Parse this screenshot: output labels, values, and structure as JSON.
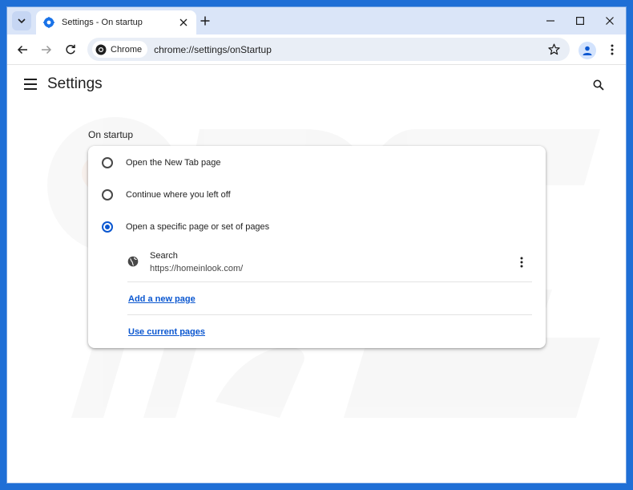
{
  "tab": {
    "title": "Settings - On startup"
  },
  "toolbar": {
    "chip_label": "Chrome",
    "url": "chrome://settings/onStartup"
  },
  "settings": {
    "title": "Settings",
    "section_title": "On startup",
    "options": [
      {
        "label": "Open the New Tab page",
        "checked": false
      },
      {
        "label": "Continue where you left off",
        "checked": false
      },
      {
        "label": "Open a specific page or set of pages",
        "checked": true
      }
    ],
    "pages": [
      {
        "name": "Search",
        "url": "https://homeinlook.com/"
      }
    ],
    "add_page_label": "Add a new page",
    "use_current_label": "Use current pages"
  },
  "colors": {
    "accent": "#0b57d0",
    "frame": "#1f6fd6",
    "tabbar": "#dae5f8"
  },
  "icons": [
    "tab-search-icon",
    "settings-gear-icon",
    "close-icon",
    "plus-icon",
    "minimize-icon",
    "maximize-icon",
    "window-close-icon",
    "back-arrow-icon",
    "forward-arrow-icon",
    "reload-icon",
    "chrome-logo-icon",
    "star-icon",
    "profile-icon",
    "kebab-menu-icon",
    "hamburger-icon",
    "search-icon",
    "globe-icon"
  ]
}
